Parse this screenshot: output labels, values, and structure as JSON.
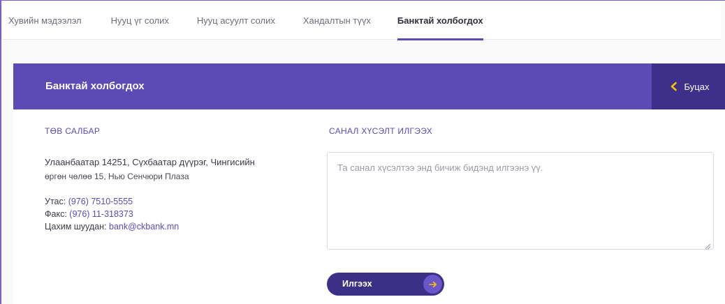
{
  "tabs": [
    {
      "label": "Хувийн мэдээлэл"
    },
    {
      "label": "Нууц үг солих"
    },
    {
      "label": "Нууц асуулт солих"
    },
    {
      "label": "Хандалтын түүх"
    },
    {
      "label": "Банктай холбогдох"
    }
  ],
  "active_tab": "Банктай холбогдох",
  "header": {
    "title": "Банктай холбогдох",
    "back_label": "Буцах"
  },
  "branch": {
    "title": "ТӨВ САЛБАР",
    "address_line1": "Улаанбаатар 14251, Сүхбаатар дүүрэг, Чингисийн",
    "address_line2": "өргөн чөлөө 15, Нью Сенчюри Плаза",
    "phone_label": "Утас:",
    "phone_value": "(976) 7510-5555",
    "fax_label": "Факс:",
    "fax_value": "(976) 11-318373",
    "email_label": "Цахим шуудан:",
    "email_value": "bank@ckbank.mn"
  },
  "feedback": {
    "title": "САНАЛ ХҮСЭЛТ ИЛГЭЭХ",
    "placeholder": "Та санал хүсэлтээ энд бичиж бидэнд илгээнэ үү.",
    "value": "",
    "send_label": "Илгээх"
  },
  "colors": {
    "accent": "#5c4bb5",
    "accent_dark": "#3e2f8a",
    "button_dark": "#3b2f86",
    "arrow_yellow": "#f5c400"
  },
  "icons": {
    "back": "chevron-left-icon",
    "send": "arrow-right-icon"
  }
}
